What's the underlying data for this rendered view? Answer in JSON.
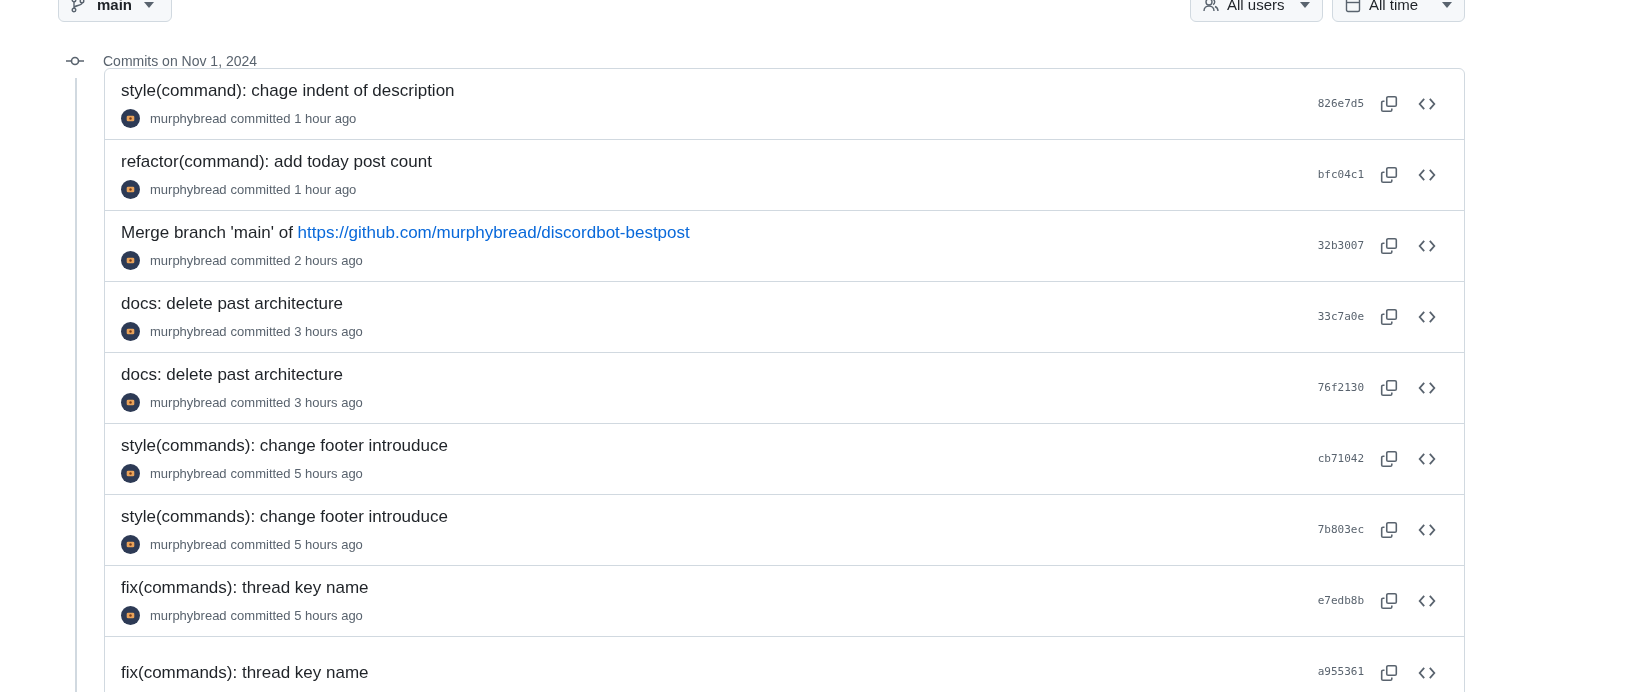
{
  "branch_button": {
    "label": "main"
  },
  "filters": [
    {
      "kind": "users",
      "label": "All users"
    },
    {
      "kind": "time",
      "label": "All time"
    }
  ],
  "group": {
    "heading": "Commits on Nov 1, 2024"
  },
  "commits": [
    {
      "title": "style(command): chage indent of description",
      "author": "murphybread",
      "time": "committed 1 hour ago",
      "hash": "826e7d5"
    },
    {
      "title": "refactor(command): add today post count",
      "author": "murphybread",
      "time": "committed 1 hour ago",
      "hash": "bfc04c1"
    },
    {
      "title": "Merge branch 'main' of ",
      "link": "https://github.com/murphybread/discordbot-bestpost",
      "author": "murphybread",
      "time": "committed 2 hours ago",
      "hash": "32b3007"
    },
    {
      "title": "docs: delete past architecture",
      "author": "murphybread",
      "time": "committed 3 hours ago",
      "hash": "33c7a0e"
    },
    {
      "title": "docs: delete past architecture",
      "author": "murphybread",
      "time": "committed 3 hours ago",
      "hash": "76f2130"
    },
    {
      "title": "style(commands): change footer introuduce",
      "author": "murphybread",
      "time": "committed 5 hours ago",
      "hash": "cb71042"
    },
    {
      "title": "style(commands): change footer introuduce",
      "author": "murphybread",
      "time": "committed 5 hours ago",
      "hash": "7b803ec"
    },
    {
      "title": "fix(commands): thread key name",
      "author": "murphybread",
      "time": "committed 5 hours ago",
      "hash": "e7edb8b"
    },
    {
      "title": "fix(commands): thread key name",
      "hash": "a955361"
    }
  ]
}
